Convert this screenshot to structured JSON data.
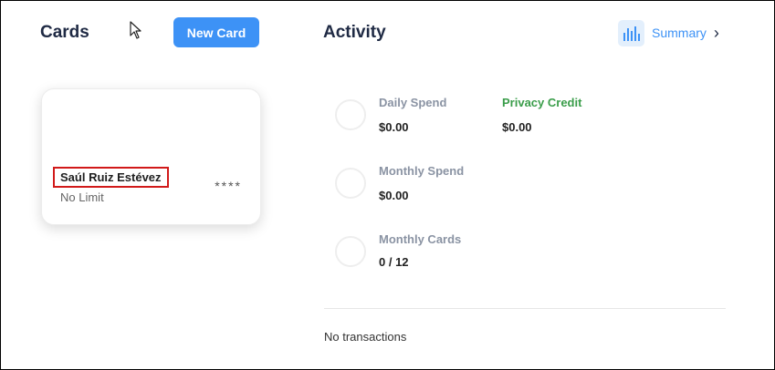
{
  "cards_section": {
    "title": "Cards",
    "new_card_label": "New Card"
  },
  "card": {
    "name": "Saúl Ruiz Estévez",
    "limit": "No Limit",
    "masked_number": "****"
  },
  "activity": {
    "title": "Activity",
    "summary_label": "Summary",
    "stats": {
      "daily_spend": {
        "label": "Daily Spend",
        "value": "$0.00"
      },
      "privacy_credit": {
        "label": "Privacy Credit",
        "value": "$0.00"
      },
      "monthly_spend": {
        "label": "Monthly Spend",
        "value": "$0.00"
      },
      "monthly_cards": {
        "label": "Monthly Cards",
        "value": "0 / 12"
      }
    },
    "empty_message": "No transactions"
  },
  "colors": {
    "accent": "#3d92f6",
    "privacy_green": "#3a9d4a",
    "highlight_red": "#d11a1a"
  }
}
